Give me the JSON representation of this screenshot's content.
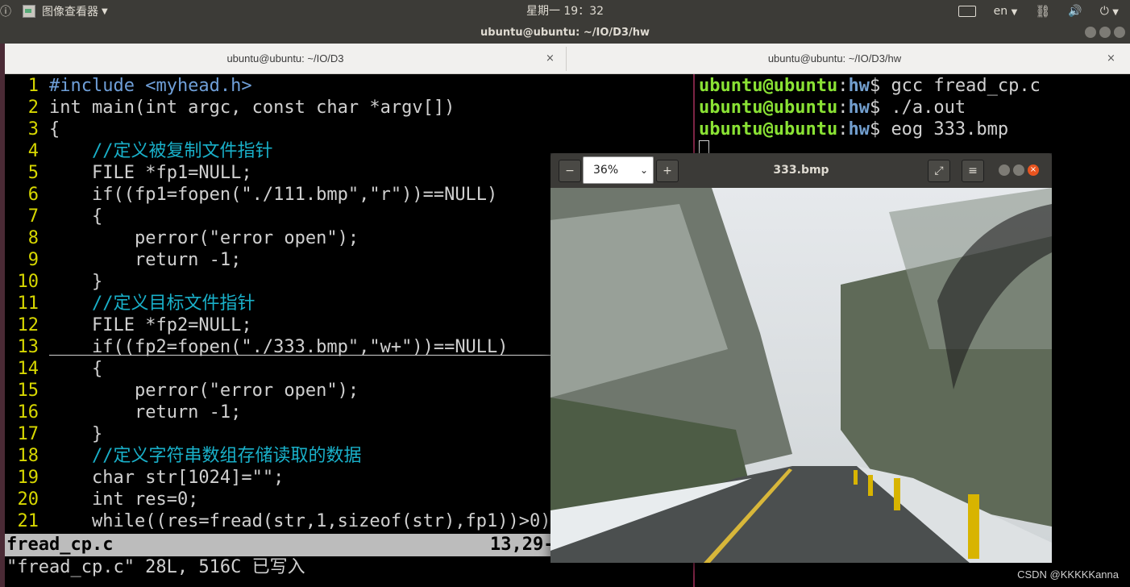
{
  "topbar": {
    "app_menu": "图像查看器",
    "clock": "星期一 19：32",
    "lang": "en"
  },
  "window": {
    "title": "ubuntu@ubuntu: ~/IO/D3/hw"
  },
  "tabs": [
    {
      "label": "ubuntu@ubuntu: ~/IO/D3",
      "close": "×"
    },
    {
      "label": "ubuntu@ubuntu: ~/IO/D3/hw",
      "close": "×"
    }
  ],
  "editor": {
    "lines": [
      {
        "n": "1",
        "text": "#include <myhead.h>"
      },
      {
        "n": "2",
        "text": "int main(int argc, const char *argv[])"
      },
      {
        "n": "3",
        "text": "{"
      },
      {
        "n": "4",
        "text": "    //定义被复制文件指针"
      },
      {
        "n": "5",
        "text": "    FILE *fp1=NULL;"
      },
      {
        "n": "6",
        "text": "    if((fp1=fopen(\"./111.bmp\",\"r\"))==NULL)"
      },
      {
        "n": "7",
        "text": "    {"
      },
      {
        "n": "8",
        "text": "        perror(\"error open\");"
      },
      {
        "n": "9",
        "text": "        return -1;"
      },
      {
        "n": "10",
        "text": "    }"
      },
      {
        "n": "11",
        "text": "    //定义目标文件指针"
      },
      {
        "n": "12",
        "text": "    FILE *fp2=NULL;"
      },
      {
        "n": "13",
        "text": "    if((fp2=fopen(\"./333.bmp\",\"w+\"))==NULL)"
      },
      {
        "n": "14",
        "text": "    {"
      },
      {
        "n": "15",
        "text": "        perror(\"error open\");"
      },
      {
        "n": "16",
        "text": "        return -1;"
      },
      {
        "n": "17",
        "text": "    }"
      },
      {
        "n": "18",
        "text": "    //定义字符串数组存储读取的数据"
      },
      {
        "n": "19",
        "text": "    char str[1024]=\"\";"
      },
      {
        "n": "20",
        "text": "    int res=0;"
      },
      {
        "n": "21",
        "text": "    while((res=fread(str,1,sizeof(str),fp1))>0)"
      }
    ],
    "status_file": "fread_cp.c",
    "status_pos": "13,29-",
    "command_line": "\"fread_cp.c\" 28L, 516C 已写入"
  },
  "terminal_right": {
    "lines": [
      {
        "user": "ubuntu@ubuntu",
        "sep": ":",
        "dir": "hw",
        "prompt": "$ ",
        "cmd": "gcc fread_cp.c"
      },
      {
        "user": "ubuntu@ubuntu",
        "sep": ":",
        "dir": "hw",
        "prompt": "$ ",
        "cmd": "./a.out"
      },
      {
        "user": "ubuntu@ubuntu",
        "sep": ":",
        "dir": "hw",
        "prompt": "$ ",
        "cmd": "eog 333.bmp"
      }
    ]
  },
  "image_viewer": {
    "title": "333.bmp",
    "zoom": "36%",
    "minus": "−",
    "plus": "+"
  },
  "watermark": "CSDN @KKKKKanna"
}
